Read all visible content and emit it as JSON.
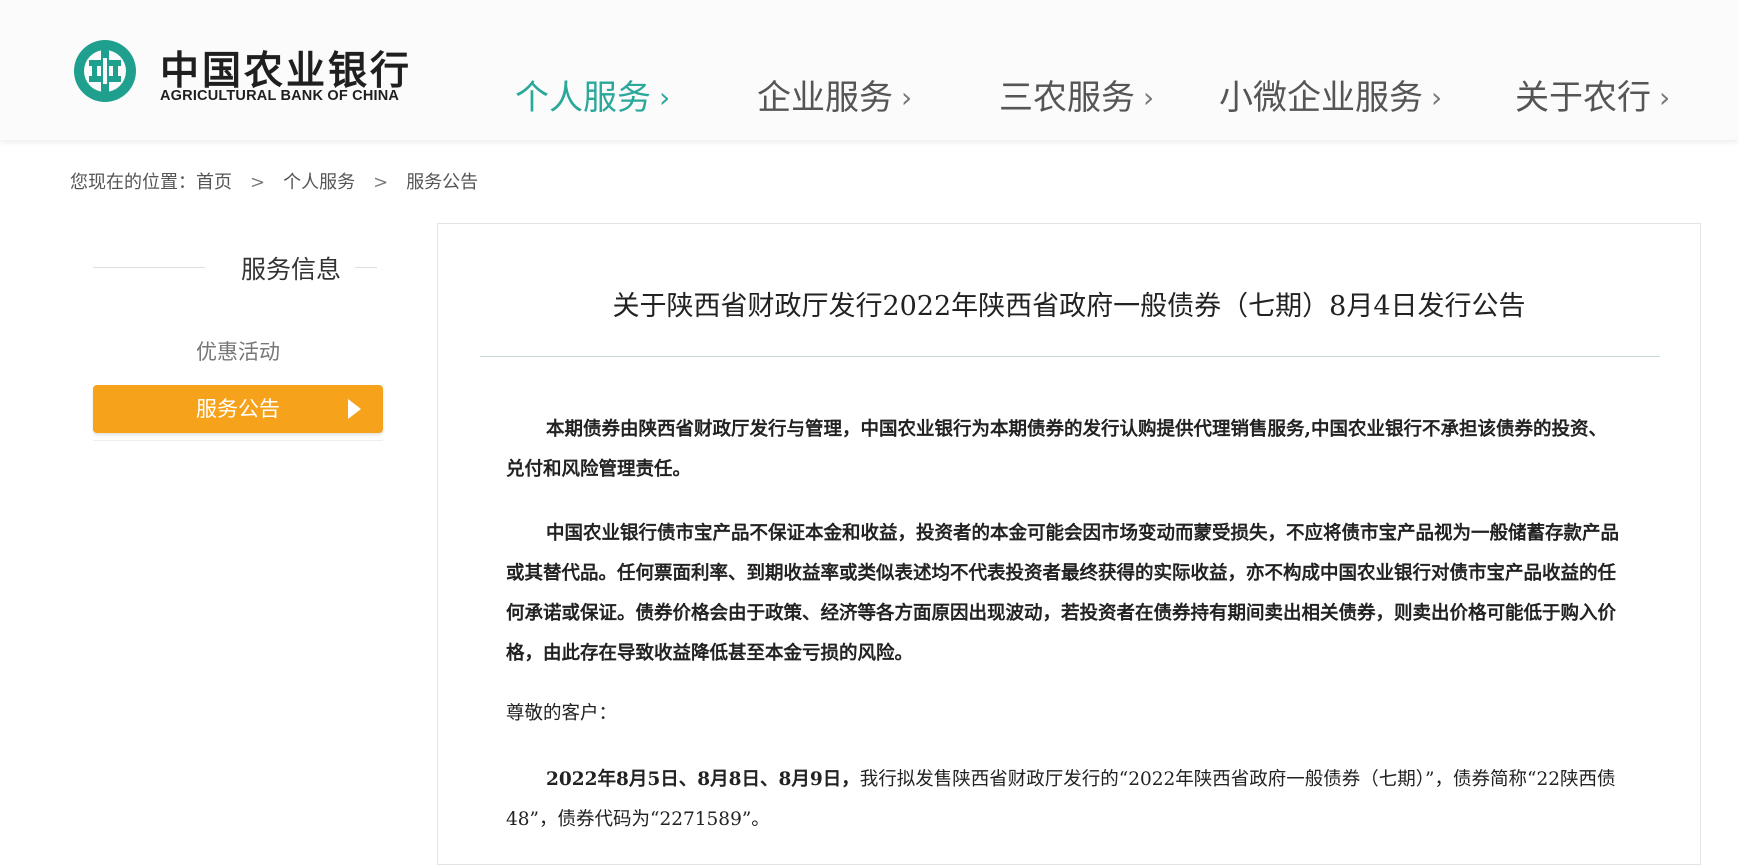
{
  "brand": {
    "name_cn": "中国农业银行",
    "name_en": "AGRICULTURAL BANK OF CHINA",
    "accent_color": "#2aa89a"
  },
  "nav": {
    "items": [
      {
        "label": "个人服务",
        "chev": "›"
      },
      {
        "label": "企业服务",
        "chev": "›"
      },
      {
        "label": "三农服务",
        "chev": "›"
      },
      {
        "label": "小微企业服务",
        "chev": "›"
      },
      {
        "label": "关于农行",
        "chev": "›"
      }
    ],
    "active_index": 0
  },
  "breadcrumb": {
    "prefix": "您现在的位置：",
    "items": [
      "首页",
      "个人服务",
      "服务公告"
    ],
    "sep": ">"
  },
  "sidebar": {
    "title": "服务信息",
    "items": [
      {
        "label": "优惠活动"
      },
      {
        "label": "服务公告"
      }
    ],
    "active_color": "#f7a21b"
  },
  "article": {
    "title": "关于陕西省财政厅发行2022年陕西省政府一般债券（七期）8月4日发行公告",
    "p1": "本期债券由陕西省财政厅发行与管理，中国农业银行为本期债券的发行认购提供代理销售服务,中国农业银行不承担该债券的投资、兑付和风险管理责任。",
    "p2": "中国农业银行债市宝产品不保证本金和收益，投资者的本金可能会因市场变动而蒙受损失，不应将债市宝产品视为一般储蓄存款产品或其替代品。任何票面利率、到期收益率或类似表述均不代表投资者最终获得的实际收益，亦不构成中国农业银行对债市宝产品收益的任何承诺或保证。债券价格会由于政策、经济等各方面原因出现波动，若投资者在债券持有期间卖出相关债券，则卖出价格可能低于购入价格，由此存在导致收益降低甚至本金亏损的风险。",
    "greeting": "尊敬的客户：",
    "p4_lead": "2022年8月5日、8月8日、8月9日，",
    "p4_rest": "我行拟发售陕西省财政厅发行的“2022年陕西省政府一般债券（七期）”，债券简称“22陕西债48”，债券代码为“2271589”。"
  }
}
